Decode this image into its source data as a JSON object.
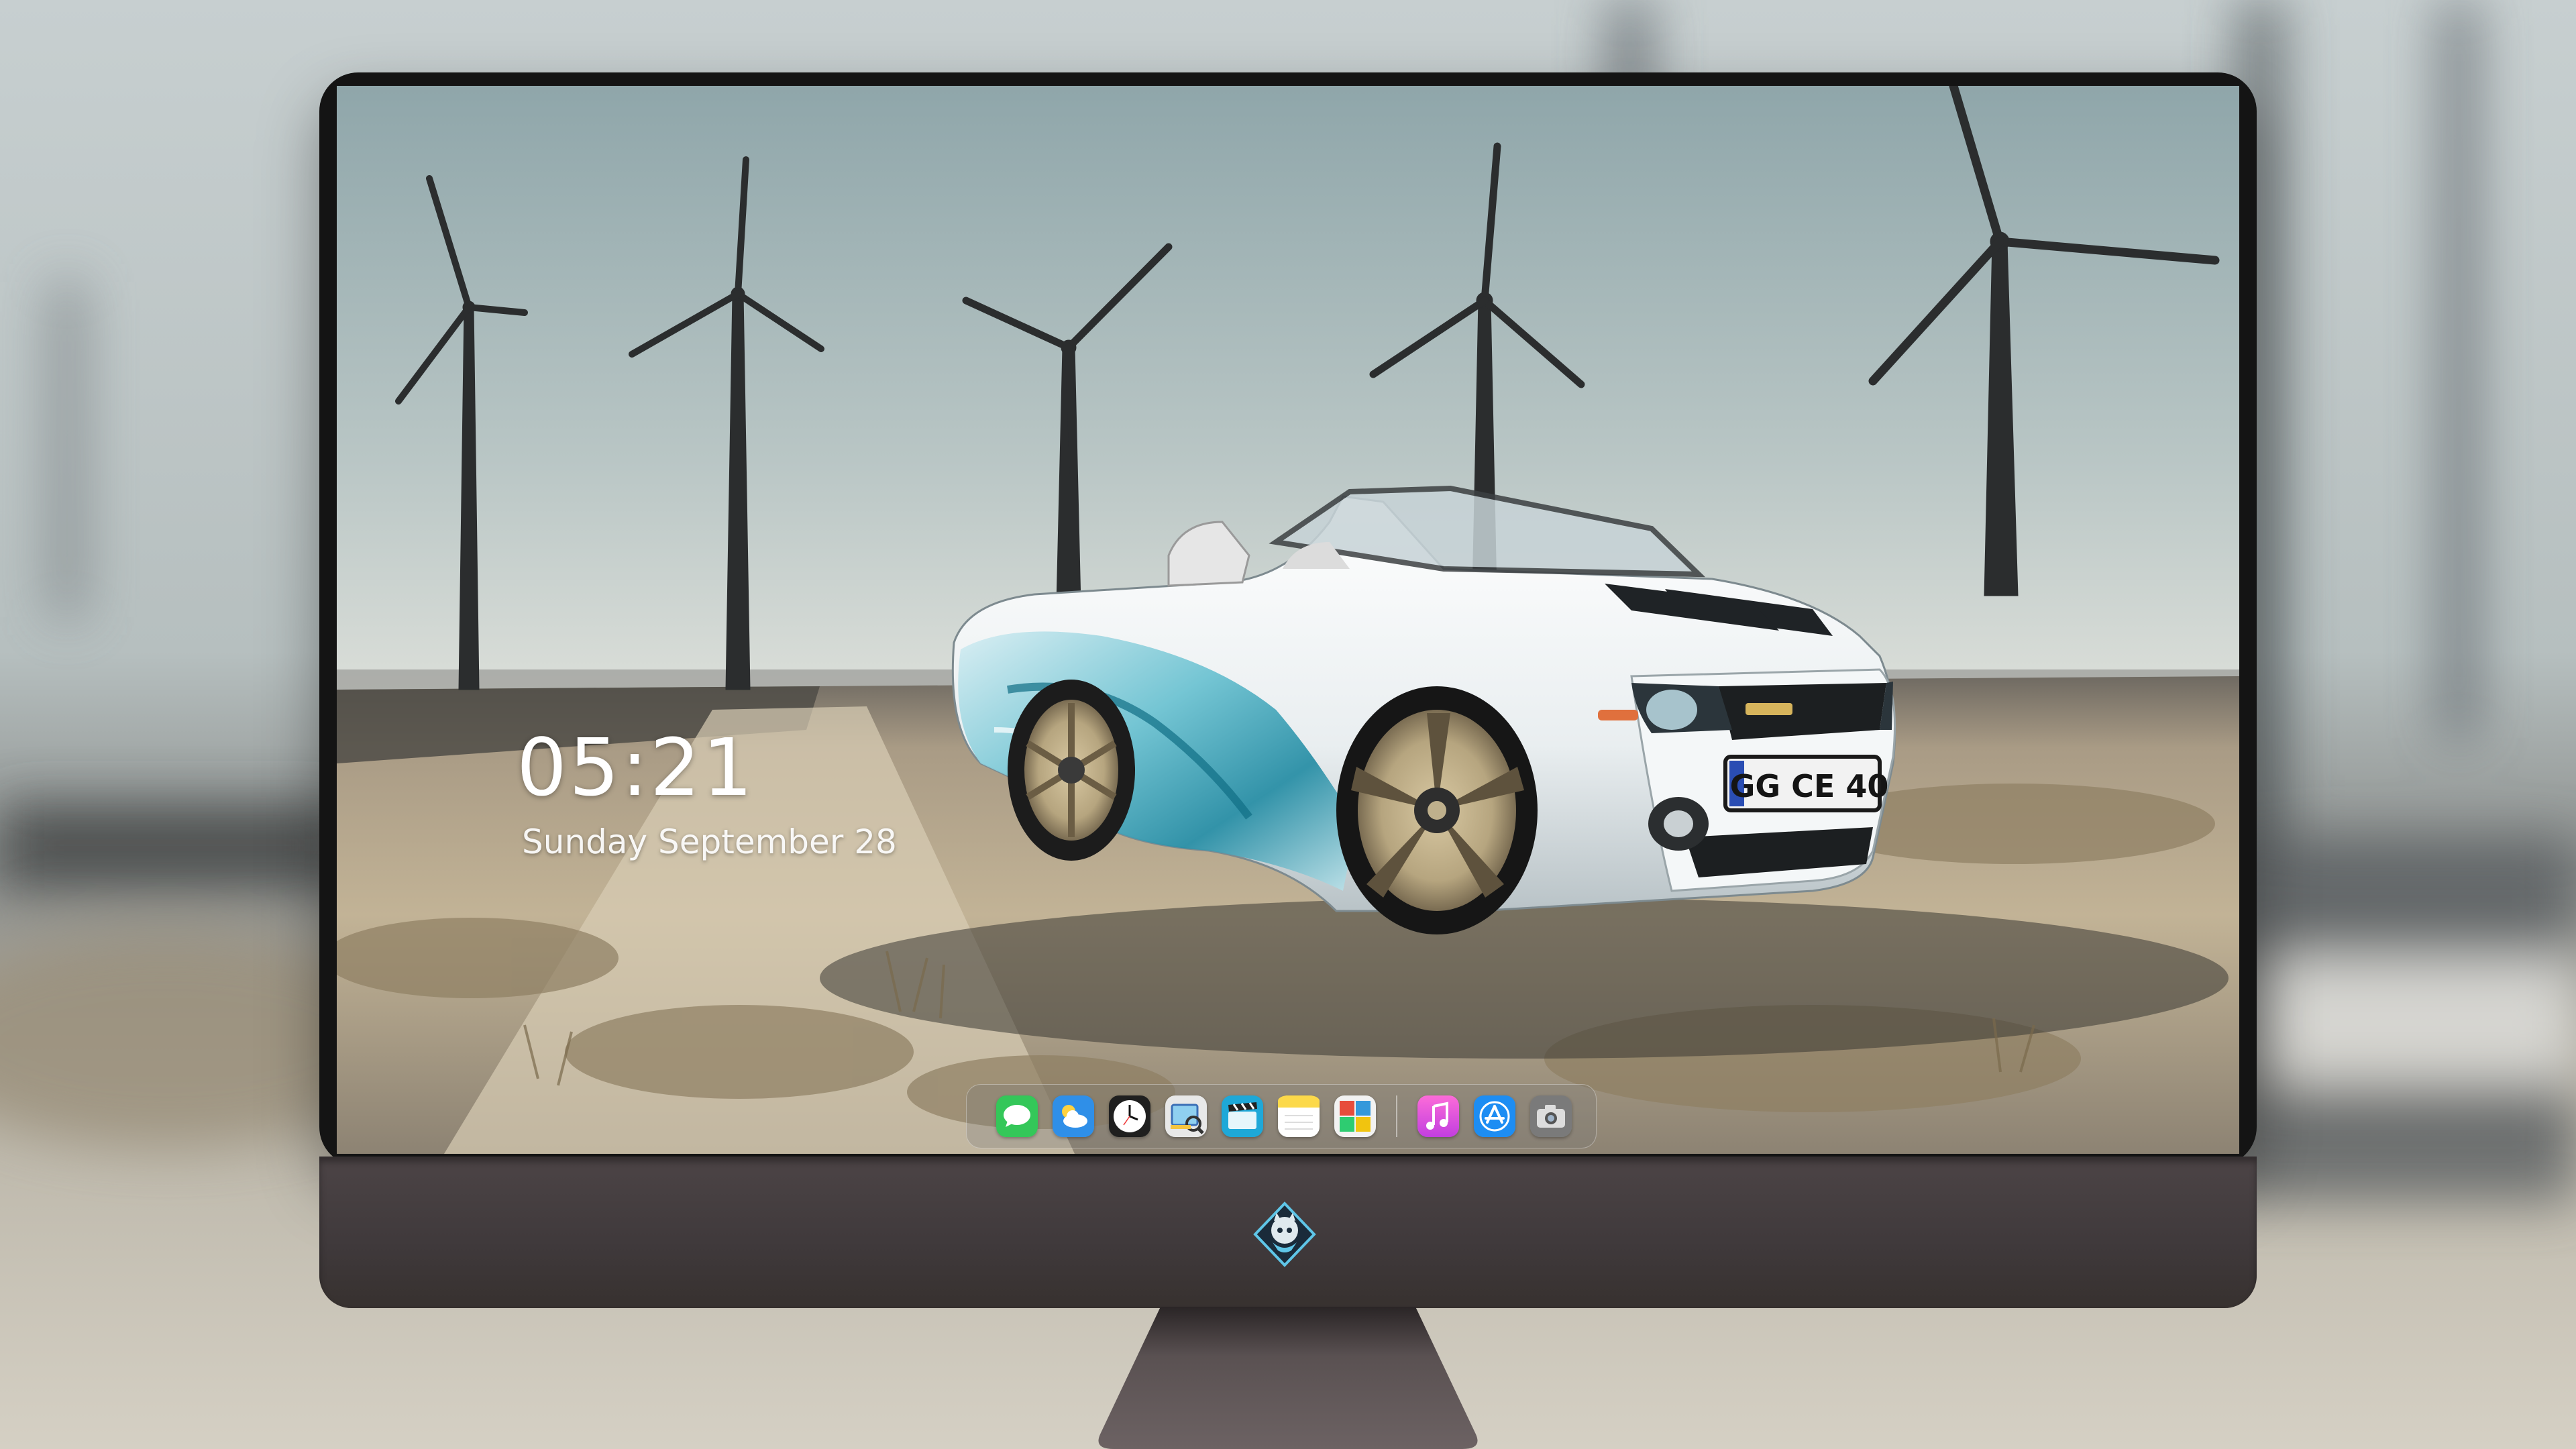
{
  "lock_screen": {
    "time": "05:21",
    "date": "Sunday September 28"
  },
  "wallpaper": {
    "license_plate": "GG CE 40",
    "scene": [
      "wind turbines",
      "white convertible car",
      "gravel road"
    ]
  },
  "dock": {
    "apps": [
      {
        "name": "Messages",
        "icon": "messages-icon",
        "color": "#34c759"
      },
      {
        "name": "Weather",
        "icon": "weather-icon",
        "color": "#2f8fe8"
      },
      {
        "name": "Clock",
        "icon": "clock-icon",
        "color": "#ffffff"
      },
      {
        "name": "Preview",
        "icon": "preview-icon",
        "color": "#f5c542"
      },
      {
        "name": "Final Cut",
        "icon": "clapperboard-icon",
        "color": "#1ea8d8"
      },
      {
        "name": "Notes",
        "icon": "notes-icon",
        "color": "#fcd94a"
      },
      {
        "name": "Photo Booth",
        "icon": "photo-booth-icon",
        "color": "#e74c3c"
      },
      {
        "name": "Music",
        "icon": "music-icon",
        "color": "#fc5dc8"
      },
      {
        "name": "App Store",
        "icon": "app-store-icon",
        "color": "#1d8df3"
      },
      {
        "name": "Screenshot",
        "icon": "camera-icon",
        "color": "#6e6e6e"
      }
    ]
  },
  "colors": {
    "bezel": "#141414",
    "chin": "#3f393b",
    "sky_top": "#9fb3b7",
    "ground": "#b7a58a"
  }
}
